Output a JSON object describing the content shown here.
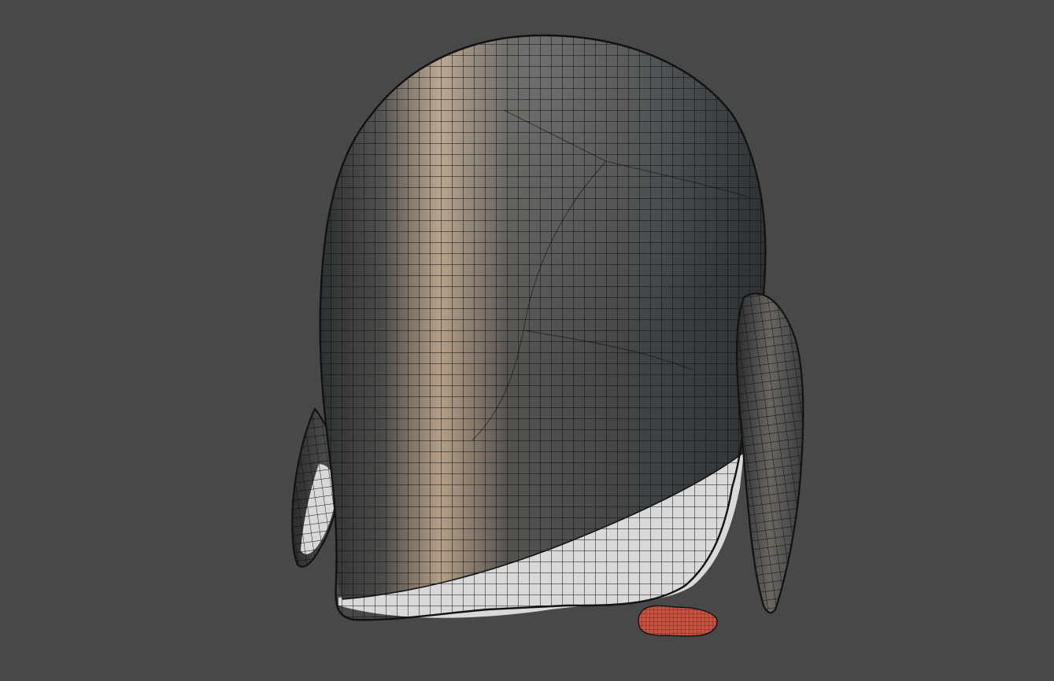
{
  "viewport": {
    "background_color": "#484848"
  },
  "model": {
    "body_color": "#3f4244",
    "belly_color": "#d9d9d9",
    "foot_color": "#c8523f",
    "wire_color": "#0d0d0d",
    "outline_color": "#121212",
    "highlight_color": "#b59f86"
  }
}
